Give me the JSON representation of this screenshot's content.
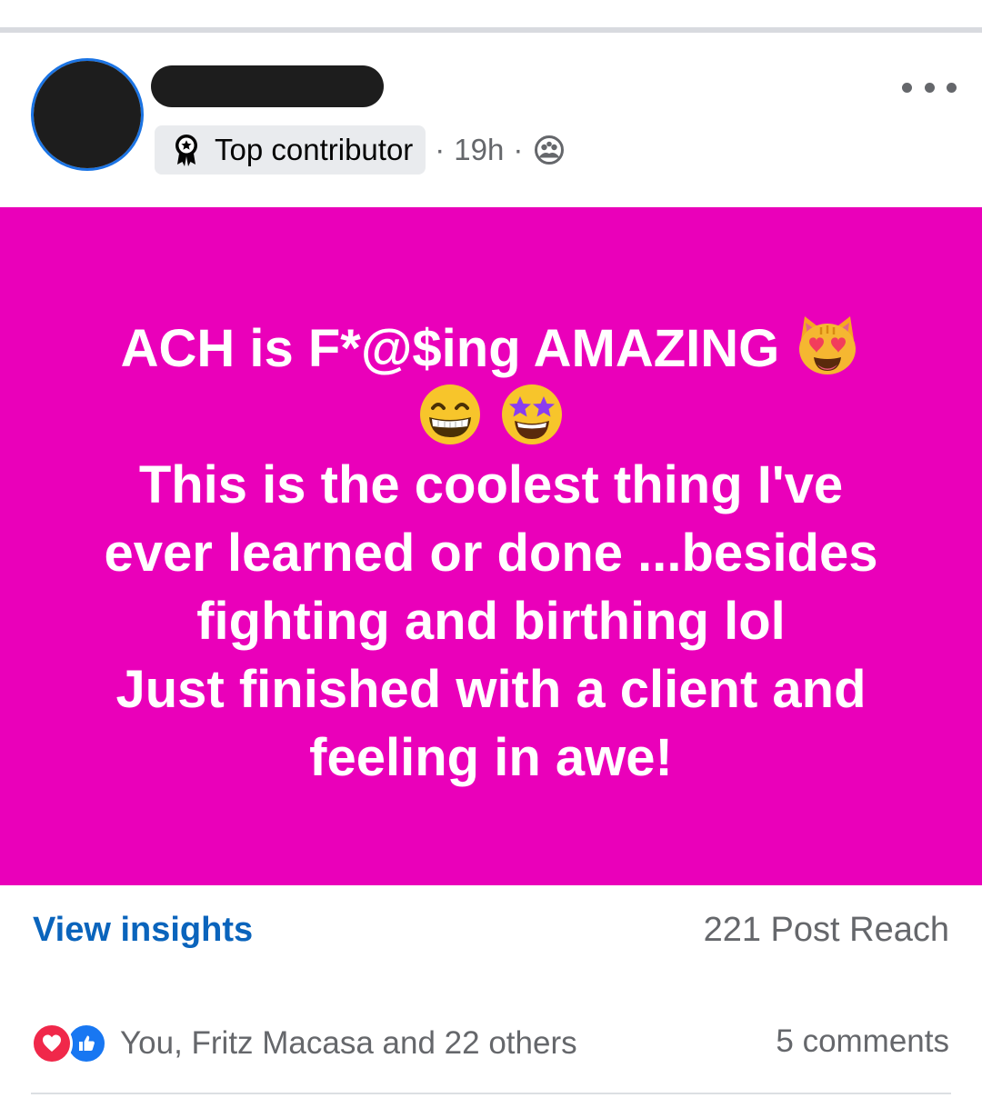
{
  "post": {
    "header": {
      "author_name": "",
      "badge_label": "Top contributor",
      "separator": "·",
      "timestamp": "19h",
      "audience_icon": "group-audience-icon",
      "more_icon": "more-options-icon"
    },
    "body": {
      "background_color": "#ea00ba",
      "text_color": "#ffffff",
      "line1": "ACH is F*@$ing AMAZING",
      "line1_emoji": "smiling-cat-heart-eyes-icon",
      "line2_emojis": [
        "grinning-face-smiling-eyes-icon",
        "star-struck-icon"
      ],
      "line3": "This is the coolest thing I've",
      "line4": "ever learned or done ...besides",
      "line5": "fighting and birthing lol",
      "line6": "Just finished with a client and",
      "line7": "feeling in awe!"
    },
    "insights": {
      "link_label": "View insights",
      "reach": "221 Post Reach"
    },
    "engagement": {
      "reaction_icons": [
        "love-reaction-icon",
        "like-reaction-icon"
      ],
      "reactions_text": "You, Fritz Macasa and 22 others",
      "comments_text": "5 comments"
    }
  },
  "colors": {
    "link_blue": "#0a64bc",
    "meta_gray": "#65676b",
    "love_red": "#f0284a",
    "like_blue": "#1877f2",
    "avatar_ring": "#1b74e4"
  }
}
